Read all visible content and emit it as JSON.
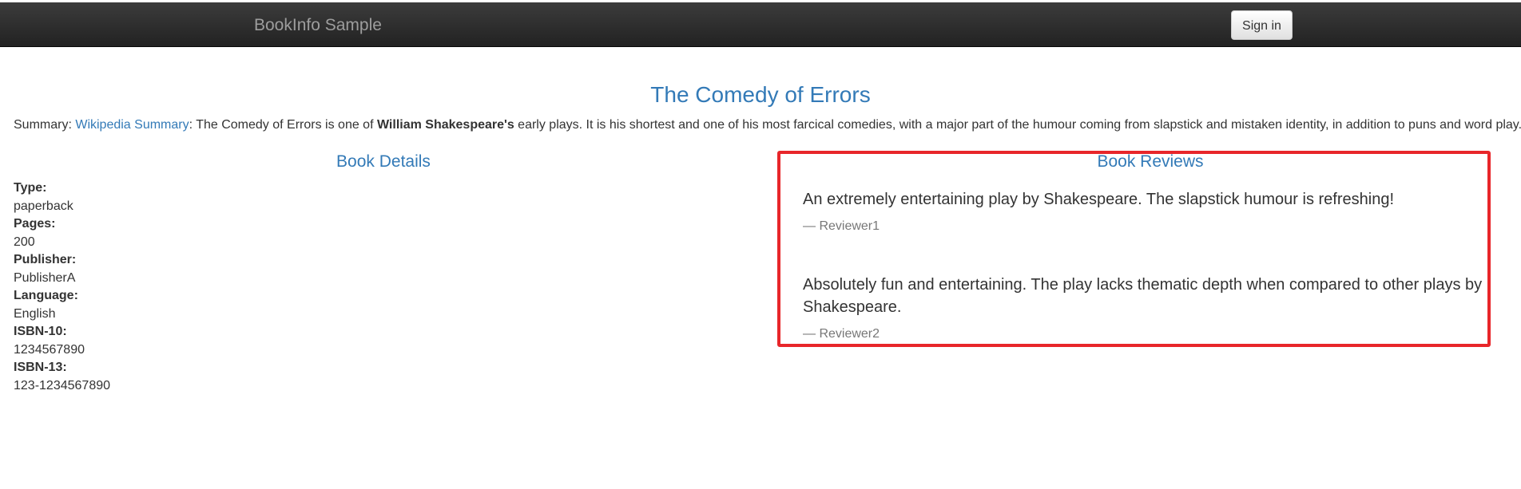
{
  "navbar": {
    "brand": "BookInfo Sample",
    "signin_label": "Sign in"
  },
  "book": {
    "title": "The Comedy of Errors",
    "summary_label": "Summary: ",
    "summary_link": "Wikipedia Summary",
    "summary_text_1": ": The Comedy of Errors is one of ",
    "summary_author": "William Shakespeare's",
    "summary_text_2": " early plays. It is his shortest and one of his most farcical comedies, with a major part of the humour coming from slapstick and mistaken identity, in addition to puns and word play."
  },
  "details": {
    "heading": "Book Details",
    "items": [
      {
        "label": "Type:",
        "value": "paperback"
      },
      {
        "label": "Pages:",
        "value": "200"
      },
      {
        "label": "Publisher:",
        "value": "PublisherA"
      },
      {
        "label": "Language:",
        "value": "English"
      },
      {
        "label": "ISBN-10:",
        "value": "1234567890"
      },
      {
        "label": "ISBN-13:",
        "value": "123-1234567890"
      }
    ]
  },
  "reviews": {
    "heading": "Book Reviews",
    "highlight_color": "#e8262a",
    "items": [
      {
        "text": "An extremely entertaining play by Shakespeare. The slapstick humour is refreshing!",
        "reviewer": "— Reviewer1"
      },
      {
        "text": "Absolutely fun and entertaining. The play lacks thematic depth when compared to other plays by Shakespeare.",
        "reviewer": "— Reviewer2"
      }
    ]
  }
}
